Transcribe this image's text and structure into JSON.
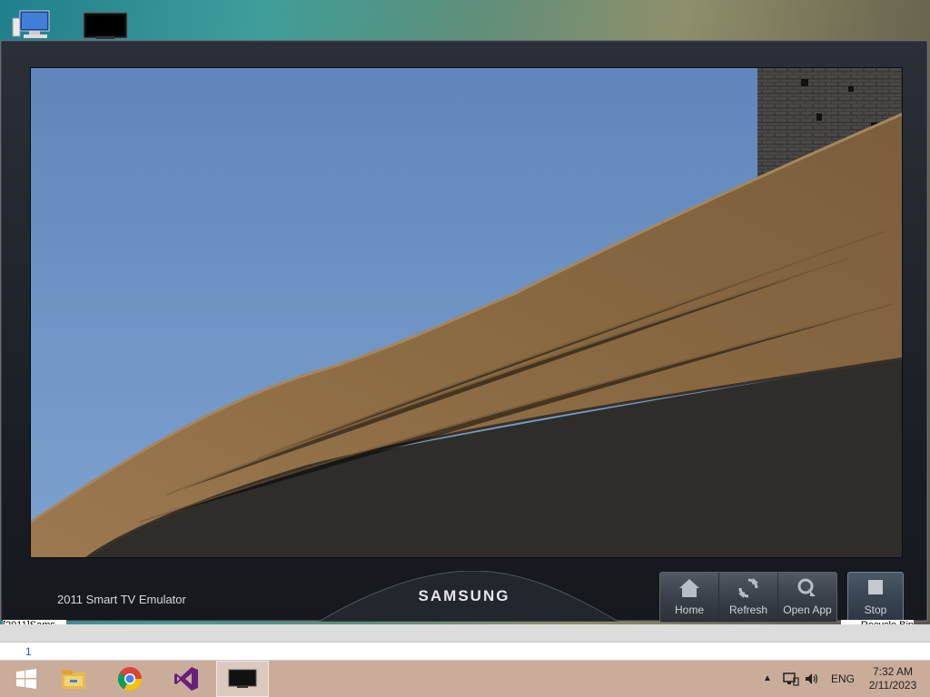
{
  "desktop": {
    "icons": [
      {
        "name": "computer",
        "label": "[2011]Sams..."
      },
      {
        "name": "tv-emulator",
        "label": "Recycle Bin"
      }
    ]
  },
  "emulator": {
    "title": "2011 Smart TV Emulator",
    "brand": "SAMSUNG",
    "controls": [
      {
        "id": "home",
        "label": "Home",
        "icon": "home-icon"
      },
      {
        "id": "refresh",
        "label": "Refresh",
        "icon": "refresh-icon"
      },
      {
        "id": "open-app",
        "label": "Open App",
        "icon": "open-app-icon"
      }
    ],
    "stop_label": "Stop"
  },
  "text_strip": {
    "input_value": "1"
  },
  "taskbar": {
    "apps": [
      "start-icon",
      "file-explorer-icon",
      "chrome-icon",
      "visual-studio-icon",
      "tv-emulator-icon"
    ],
    "tray": {
      "language": "ENG",
      "time": "7:32 AM",
      "date": "2/11/2023"
    }
  },
  "colors": {
    "sky": "#6e92c2",
    "roof": "#8a6a42",
    "wall": "#2a2a28",
    "taskbar": "#c9ad9a"
  }
}
